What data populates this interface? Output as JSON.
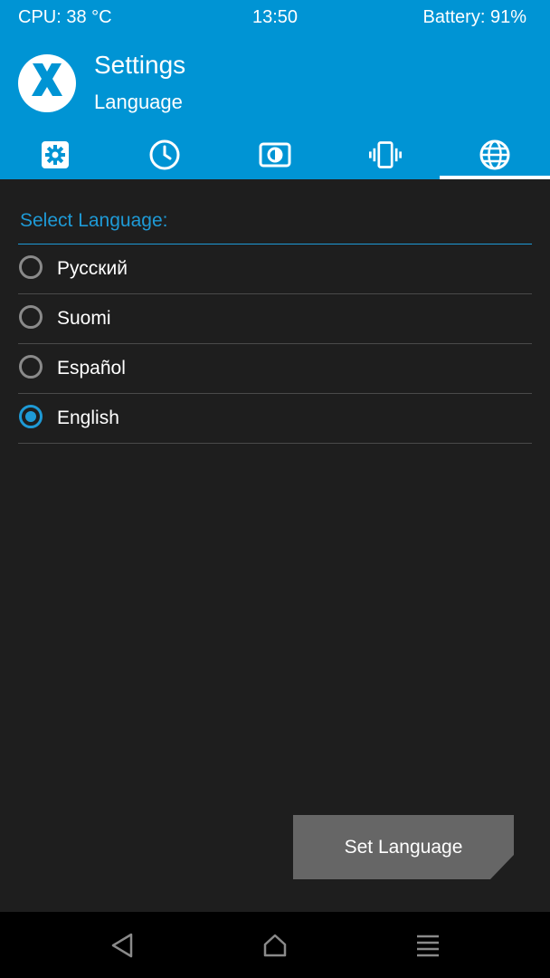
{
  "status_bar": {
    "cpu": "CPU: 38 °C",
    "time": "13:50",
    "battery": "Battery: 91%"
  },
  "header": {
    "title": "Settings",
    "subtitle": "Language",
    "logo_icon": "twrp-logo-icon",
    "tabs": [
      {
        "icon": "gear-icon",
        "active": false
      },
      {
        "icon": "clock-icon",
        "active": false
      },
      {
        "icon": "brightness-icon",
        "active": false
      },
      {
        "icon": "vibration-icon",
        "active": false
      },
      {
        "icon": "globe-icon",
        "active": true
      }
    ]
  },
  "language_section": {
    "label": "Select Language:",
    "options": [
      {
        "label": "Русский",
        "selected": false
      },
      {
        "label": "Suomi",
        "selected": false
      },
      {
        "label": "Español",
        "selected": false
      },
      {
        "label": "English",
        "selected": true
      }
    ]
  },
  "actions": {
    "set_language_label": "Set Language"
  },
  "nav_bar": {
    "buttons": [
      "back-icon",
      "home-icon",
      "menu-icon"
    ]
  },
  "colors": {
    "accent": "#0094d4",
    "selection": "#1e9ad6",
    "background": "#1e1e1e",
    "button": "#666666"
  }
}
